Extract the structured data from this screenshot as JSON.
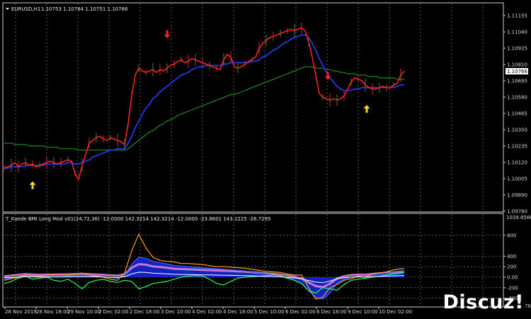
{
  "main_panel": {
    "symbol_label": "EURUSD,H1",
    "ohlc": "1.10753 1.10784 1.10751 1.10766",
    "current_price": "1.10766",
    "price_labels": [
      "1.11155",
      "1.11040",
      "1.10925",
      "1.10810",
      "1.10695",
      "1.10580",
      "1.10465",
      "1.10350",
      "1.10235",
      "1.10120",
      "1.10005",
      "1.09890",
      "1.09780"
    ]
  },
  "sub_panel": {
    "indicator_title": "T_Kaede BMI Long Mod v01(24,72,36) -12.0000 142.3214 142.3214 -12.0000 -23.8601 143.2225 -26.7295",
    "top_value": "1039.8566",
    "level_labels": [
      "800",
      "400",
      "200",
      "0.00",
      "-200",
      "-400"
    ]
  },
  "time_labels": [
    "28 Nov 2019",
    "28 Nov 18:00",
    "29 Nov 10:00",
    "2 Dec 02:00",
    "2 Dec 18:00",
    "3 Dec 10:00",
    "4 Dec 02:00",
    "4 Dec 18:00",
    "5 Dec 10:00",
    "6 Dec 02:00",
    "6 Dec 18:00",
    "9 Dec 10:00",
    "10 Dec 02:00"
  ],
  "watermark": {
    "text": "Discuz!",
    "sub": "76"
  },
  "colors": {
    "price_line": "#ff2020",
    "ma_fast": "#2040ff",
    "ma_slow": "#1e8a1e",
    "grid": "#d0d0d0",
    "arrow_sell": "#ff2020",
    "arrow_buy": "#ffd21e",
    "histogram": "#1a2cff"
  },
  "chart_data": [
    {
      "type": "line",
      "ylim": [
        1.0978,
        1.1124
      ],
      "x": [
        0,
        5,
        10,
        15,
        20,
        25,
        30,
        35,
        40,
        45,
        50,
        55,
        60,
        65,
        70,
        75,
        80,
        85,
        90,
        95,
        100,
        105,
        110,
        115,
        120,
        125,
        130,
        135,
        140,
        145,
        150,
        155,
        160,
        165,
        170,
        175,
        180,
        185,
        190,
        195,
        200,
        205,
        210,
        215,
        220,
        225,
        230,
        235,
        240,
        245,
        250,
        255,
        260,
        265,
        270,
        275,
        280,
        285,
        290,
        295,
        300,
        305,
        310,
        315,
        320,
        325,
        330,
        335,
        340,
        345,
        350,
        355,
        360,
        365,
        370,
        375,
        380,
        385,
        390,
        395,
        400,
        405,
        410,
        415,
        420,
        425,
        430,
        435,
        440,
        445,
        450,
        455,
        460,
        465,
        470,
        475,
        480,
        485,
        490,
        495,
        500,
        505,
        510,
        515,
        520,
        525,
        530,
        535,
        540,
        545,
        550,
        555,
        560,
        565
      ],
      "series": [
        {
          "values": [
            1.1008,
            1.1009,
            1.101,
            1.1012,
            1.1009,
            1.1011,
            1.1012,
            1.101,
            1.1011,
            1.1009,
            1.101,
            1.1011,
            1.1012,
            1.1013,
            1.1012,
            1.1011,
            1.1012,
            1.1013,
            1.1014,
            1.1013,
            1.1004,
            1.1,
            1.101,
            1.1018,
            1.1026,
            1.1028,
            1.103,
            1.1031,
            1.1029,
            1.1028,
            1.103,
            1.1029,
            1.1028,
            1.1027,
            1.1025,
            1.104,
            1.106,
            1.1075,
            1.108,
            1.1078,
            1.1077,
            1.1078,
            1.1079,
            1.1077,
            1.1079,
            1.1078,
            1.108,
            1.1082,
            1.1083,
            1.1085,
            1.1086,
            1.1084,
            1.1085,
            1.1087,
            1.1086,
            1.1085,
            1.1084,
            1.1083,
            1.1082,
            1.1081,
            1.108,
            1.1079,
            1.1086,
            1.109,
            1.1088,
            1.1081,
            1.108,
            1.1081,
            1.1083,
            1.1085,
            1.1086,
            1.1088,
            1.1094,
            1.1098,
            1.11,
            1.1102,
            1.1103,
            1.1104,
            1.1105,
            1.1106,
            1.1107,
            1.1108,
            1.1107,
            1.1108,
            1.1109,
            1.1107,
            1.1099,
            1.1088,
            1.1075,
            1.1062,
            1.1059,
            1.1058,
            1.1057,
            1.1058,
            1.1057,
            1.1058,
            1.106,
            1.1065,
            1.107,
            1.1073,
            1.1072,
            1.1071,
            1.1068,
            1.1066,
            1.1065,
            1.1065,
            1.1066,
            1.1067,
            1.1066,
            1.1066,
            1.1068,
            1.1069,
            1.1075,
            1.1078
          ]
        },
        {
          "values": [
            1.1008,
            1.1008,
            1.1009,
            1.1009,
            1.1009,
            1.1009,
            1.101,
            1.101,
            1.101,
            1.101,
            1.101,
            1.101,
            1.1011,
            1.1011,
            1.1011,
            1.1011,
            1.1011,
            1.1011,
            1.1012,
            1.1012,
            1.1011,
            1.1011,
            1.1012,
            1.1013,
            1.1014,
            1.1016,
            1.1017,
            1.1018,
            1.1019,
            1.102,
            1.1021,
            1.1021,
            1.1022,
            1.1022,
            1.1022,
            1.1026,
            1.1031,
            1.1037,
            1.1042,
            1.1047,
            1.1051,
            1.1054,
            1.1058,
            1.106,
            1.1063,
            1.1065,
            1.1067,
            1.1069,
            1.1071,
            1.1073,
            1.1075,
            1.1076,
            1.1077,
            1.1079,
            1.108,
            1.1081,
            1.1081,
            1.1082,
            1.1082,
            1.1082,
            1.1082,
            1.1082,
            1.1083,
            1.1083,
            1.1084,
            1.1084,
            1.1084,
            1.1084,
            1.1084,
            1.1084,
            1.1085,
            1.1085,
            1.1086,
            1.1088,
            1.1089,
            1.1091,
            1.1093,
            1.1094,
            1.1096,
            1.1098,
            1.1099,
            1.1101,
            1.1102,
            1.1103,
            1.1104,
            1.1104,
            1.1102,
            1.1098,
            1.1093,
            1.1087,
            1.1082,
            1.1077,
            1.1073,
            1.107,
            1.1067,
            1.1065,
            1.1064,
            1.1064,
            1.1064,
            1.1065,
            1.1065,
            1.1066,
            1.1066,
            1.1066,
            1.1066,
            1.1066,
            1.1066,
            1.1066,
            1.1066,
            1.1066,
            1.1066,
            1.1067,
            1.1068,
            1.1068
          ]
        },
        {
          "values": [
            1.1026,
            1.1026,
            1.1026,
            1.1025,
            1.1025,
            1.1025,
            1.1025,
            1.1024,
            1.1024,
            1.1024,
            1.1024,
            1.1024,
            1.1023,
            1.1023,
            1.1023,
            1.1023,
            1.1022,
            1.1022,
            1.1022,
            1.1022,
            1.1022,
            1.1021,
            1.1021,
            1.1021,
            1.1021,
            1.1021,
            1.1021,
            1.1021,
            1.1021,
            1.1021,
            1.1021,
            1.1021,
            1.1021,
            1.1021,
            1.1021,
            1.1022,
            1.1024,
            1.1026,
            1.1028,
            1.103,
            1.1032,
            1.1034,
            1.1035,
            1.1037,
            1.1039,
            1.104,
            1.1042,
            1.1043,
            1.1044,
            1.1046,
            1.1047,
            1.1048,
            1.1049,
            1.105,
            1.1051,
            1.1052,
            1.1053,
            1.1054,
            1.1055,
            1.1056,
            1.1057,
            1.1058,
            1.1059,
            1.106,
            1.1061,
            1.1061,
            1.1062,
            1.1063,
            1.1064,
            1.1065,
            1.1066,
            1.1067,
            1.1068,
            1.1069,
            1.107,
            1.1071,
            1.1072,
            1.1073,
            1.1074,
            1.1075,
            1.1076,
            1.1077,
            1.1078,
            1.1079,
            1.108,
            1.1081,
            1.1081,
            1.1081,
            1.108,
            1.108,
            1.108,
            1.1079,
            1.1079,
            1.1078,
            1.1078,
            1.1077,
            1.1077,
            1.1076,
            1.1076,
            1.1076,
            1.1075,
            1.1075,
            1.1075,
            1.1074,
            1.1074,
            1.1074,
            1.1073,
            1.1073,
            1.1073,
            1.1073,
            1.1073,
            1.1072,
            1.1072,
            1.1072
          ]
        }
      ],
      "sell_arrows": [
        [
          230,
          1.1094
        ],
        [
          457,
          1.1064
        ]
      ],
      "buy_arrows": [
        [
          40,
          1.0996
        ],
        [
          512,
          1.1051
        ]
      ]
    },
    {
      "type": "area",
      "ylim": [
        -500,
        1040
      ],
      "x": [
        0,
        10,
        20,
        30,
        40,
        50,
        60,
        70,
        80,
        90,
        100,
        110,
        120,
        130,
        140,
        150,
        160,
        170,
        180,
        190,
        200,
        210,
        220,
        230,
        240,
        250,
        260,
        270,
        280,
        290,
        300,
        310,
        320,
        330,
        340,
        350,
        360,
        370,
        380,
        390,
        400,
        410,
        420,
        430,
        440,
        450,
        460,
        470,
        480,
        490,
        500,
        510,
        520,
        530,
        540,
        550,
        560,
        565
      ],
      "series": [
        {
          "values": [
            -40,
            -20,
            10,
            30,
            20,
            10,
            20,
            10,
            15,
            25,
            30,
            40,
            30,
            20,
            10,
            -10,
            -20,
            30,
            250,
            380,
            360,
            300,
            280,
            250,
            220,
            210,
            200,
            190,
            180,
            170,
            160,
            150,
            140,
            130,
            120,
            100,
            80,
            60,
            40,
            20,
            -20,
            -60,
            -120,
            -260,
            -380,
            -420,
            -300,
            -120,
            -40,
            0,
            20,
            10,
            40,
            60,
            80,
            100,
            120,
            120
          ]
        },
        {
          "values": [
            -60,
            -30,
            0,
            40,
            30,
            20,
            40,
            60,
            60,
            40,
            60,
            80,
            40,
            20,
            0,
            -40,
            -60,
            80,
            500,
            820,
            560,
            380,
            320,
            300,
            290,
            260,
            260,
            250,
            240,
            220,
            200,
            200,
            190,
            180,
            170,
            150,
            130,
            110,
            100,
            90,
            60,
            40,
            40,
            -200,
            -420,
            -380,
            -200,
            -140,
            -60,
            -30,
            20,
            0,
            60,
            80,
            100,
            140,
            160,
            160
          ]
        },
        {
          "values": [
            -120,
            -80,
            -20,
            20,
            -40,
            -20,
            0,
            -60,
            -80,
            -40,
            -120,
            -220,
            -100,
            -60,
            -40,
            -80,
            -100,
            -60,
            -80,
            -220,
            -180,
            -120,
            -100,
            -80,
            -40,
            0,
            20,
            30,
            20,
            -40,
            -120,
            -150,
            -80,
            -20,
            0,
            10,
            20,
            30,
            40,
            30,
            -20,
            -60,
            -120,
            -260,
            -300,
            -200,
            -220,
            -250,
            -140,
            -60,
            -40,
            -20,
            0,
            20,
            40,
            60,
            80,
            90
          ]
        }
      ]
    }
  ]
}
